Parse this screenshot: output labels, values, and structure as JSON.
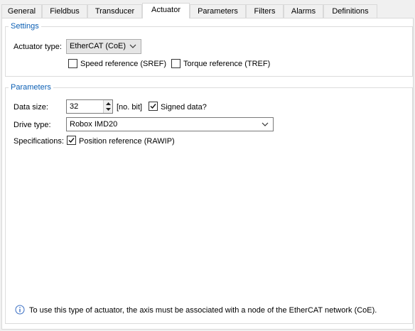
{
  "tabs": [
    {
      "label": "General"
    },
    {
      "label": "Fieldbus"
    },
    {
      "label": "Transducer"
    },
    {
      "label": "Actuator"
    },
    {
      "label": "Parameters"
    },
    {
      "label": "Filters"
    },
    {
      "label": "Alarms"
    },
    {
      "label": "Definitions"
    }
  ],
  "active_tab": "Actuator",
  "settings": {
    "title": "Settings",
    "actuator_type_label": "Actuator type:",
    "actuator_type_value": "EtherCAT (CoE)",
    "speed_reference_label": "Speed reference (SREF)",
    "speed_reference_checked": false,
    "torque_reference_label": "Torque reference (TREF)",
    "torque_reference_checked": false
  },
  "parameters": {
    "title": "Parameters",
    "data_size_label": "Data size:",
    "data_size_value": "32",
    "data_size_unit": "[no. bit]",
    "signed_data_label": "Signed data?",
    "signed_data_checked": true,
    "drive_type_label": "Drive type:",
    "drive_type_value": "Robox IMD20",
    "specifications_label": "Specifications:",
    "position_reference_label": "Position reference (RAWIP)",
    "position_reference_checked": true
  },
  "info": {
    "icon": "info-icon",
    "text": "To use this type of actuator, the axis must be associated with a node of the EtherCAT network (CoE)."
  },
  "colors": {
    "group_title": "#0b5fb4",
    "background": "#f0f0f0",
    "panel": "#ffffff"
  }
}
